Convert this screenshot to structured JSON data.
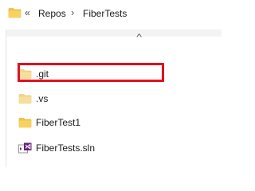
{
  "breadcrumb": {
    "overflow": "«",
    "items": [
      "Repos",
      "FiberTests"
    ],
    "separator": "›"
  },
  "list": {
    "items": [
      {
        "label": ".git",
        "icon": "folder-light-icon",
        "highlighted": true
      },
      {
        "label": ".vs",
        "icon": "folder-light-icon",
        "highlighted": false
      },
      {
        "label": "FiberTest1",
        "icon": "folder-icon",
        "highlighted": false
      },
      {
        "label": "FiberTests.sln",
        "icon": "visual-studio-solution-icon",
        "highlighted": false
      }
    ],
    "sort_indicator": "^"
  },
  "colors": {
    "highlight": "#e01020",
    "folder": "#f3c44a",
    "folder_light": "#f7df9a",
    "vs_purple": "#68217a"
  }
}
